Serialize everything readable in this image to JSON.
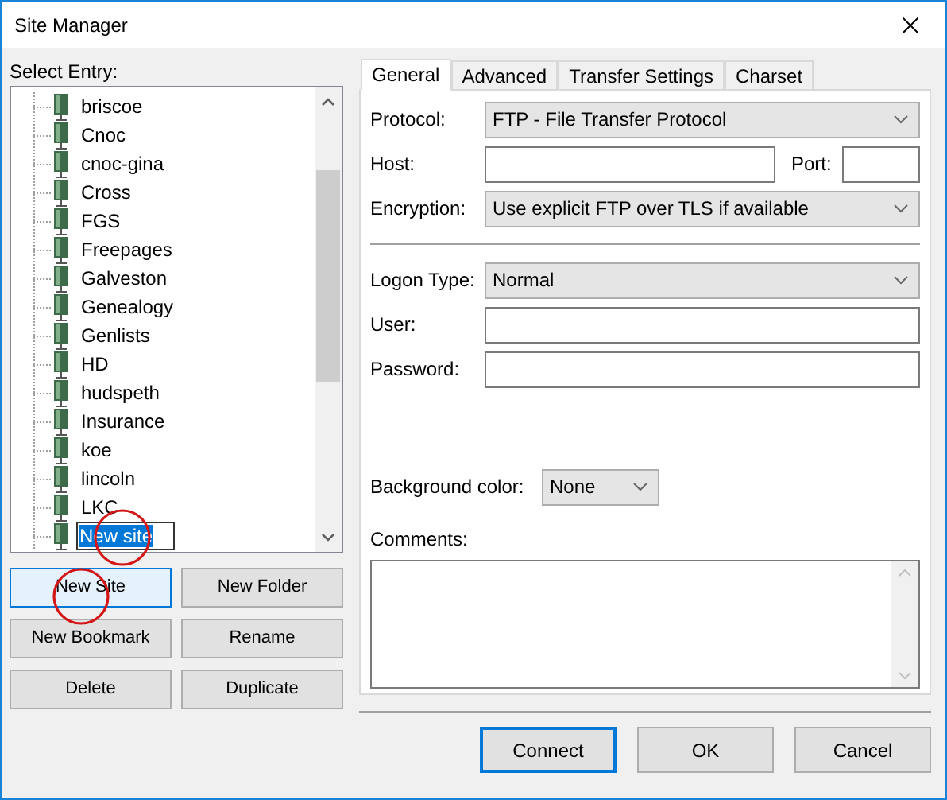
{
  "window": {
    "title": "Site Manager"
  },
  "select_entry_label": "Select Entry:",
  "tree": {
    "items": [
      {
        "label": "briscoe",
        "editing": false
      },
      {
        "label": "Cnoc",
        "editing": false
      },
      {
        "label": "cnoc-gina",
        "editing": false
      },
      {
        "label": "Cross",
        "editing": false
      },
      {
        "label": "FGS",
        "editing": false
      },
      {
        "label": "Freepages",
        "editing": false
      },
      {
        "label": "Galveston",
        "editing": false
      },
      {
        "label": "Genealogy",
        "editing": false
      },
      {
        "label": "Genlists",
        "editing": false
      },
      {
        "label": "HD",
        "editing": false
      },
      {
        "label": "hudspeth",
        "editing": false
      },
      {
        "label": "Insurance",
        "editing": false
      },
      {
        "label": "koe",
        "editing": false
      },
      {
        "label": "lincoln",
        "editing": false
      },
      {
        "label": "LKC",
        "editing": false
      },
      {
        "label": "New site",
        "editing": true
      }
    ]
  },
  "site_buttons": [
    {
      "label": "New Site",
      "hot": true
    },
    {
      "label": "New Folder",
      "hot": false
    },
    {
      "label": "New Bookmark",
      "hot": false
    },
    {
      "label": "Rename",
      "hot": false
    },
    {
      "label": "Delete",
      "hot": false
    },
    {
      "label": "Duplicate",
      "hot": false
    }
  ],
  "tabs": [
    {
      "label": "General",
      "selected": true
    },
    {
      "label": "Advanced",
      "selected": false
    },
    {
      "label": "Transfer Settings",
      "selected": false
    },
    {
      "label": "Charset",
      "selected": false
    }
  ],
  "general": {
    "protocol": {
      "label": "Protocol:",
      "value": "FTP - File Transfer Protocol"
    },
    "host": {
      "label": "Host:"
    },
    "port": {
      "label": "Port:"
    },
    "encryption": {
      "label": "Encryption:",
      "value": "Use explicit FTP over TLS if available"
    },
    "logon_type": {
      "label": "Logon Type:",
      "value": "Normal"
    },
    "user": {
      "label": "User:"
    },
    "password": {
      "label": "Password:"
    },
    "background_color": {
      "label": "Background color:",
      "value": "None"
    },
    "comments": {
      "label": "Comments:"
    }
  },
  "dialog_buttons": [
    {
      "label": "Connect",
      "default": true
    },
    {
      "label": "OK",
      "default": false
    },
    {
      "label": "Cancel",
      "default": false
    }
  ],
  "annotations": [
    {
      "kind": "circle"
    },
    {
      "kind": "circle"
    }
  ]
}
